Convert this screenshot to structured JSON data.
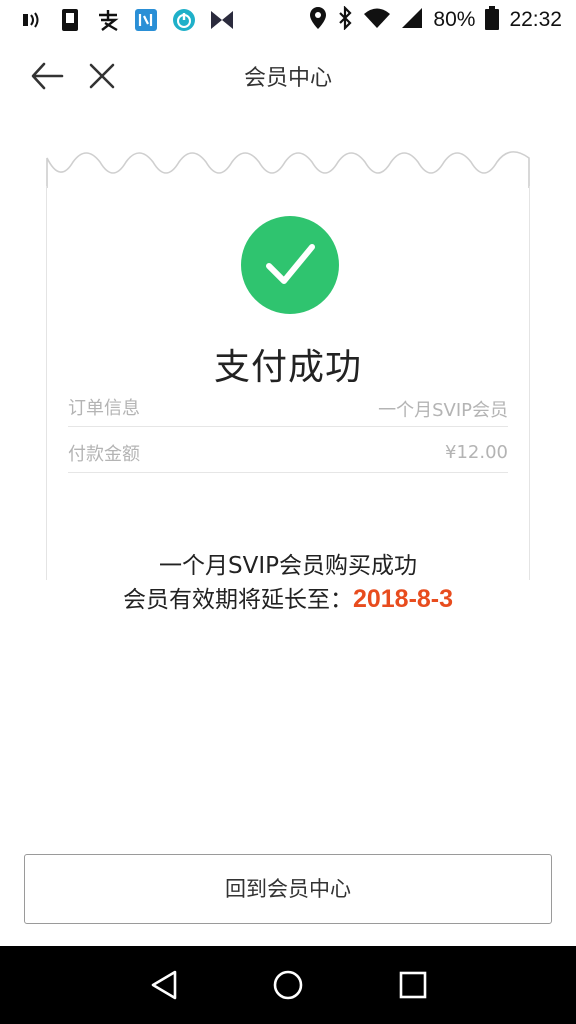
{
  "status_bar": {
    "left_icons": [
      "nfc-icon",
      "sim-card-icon",
      "alipay-icon",
      "app-icon",
      "power-icon",
      "m-logo-icon"
    ],
    "battery_percent": "80%",
    "time": "22:32"
  },
  "nav": {
    "title": "会员中心"
  },
  "receipt": {
    "status_title": "支付成功",
    "rows": [
      {
        "label": "订单信息",
        "value": "一个月SVIP会员"
      },
      {
        "label": "付款金额",
        "value": "¥12.00"
      }
    ]
  },
  "message": {
    "line1": "一个月SVIP会员购买成功",
    "line2_prefix": "会员有效期将延长至：",
    "expire_date": "2018-8-3"
  },
  "actions": {
    "back_to_center": "回到会员中心"
  },
  "colors": {
    "success_green": "#2fc46f",
    "date_orange": "#e84c1e"
  }
}
